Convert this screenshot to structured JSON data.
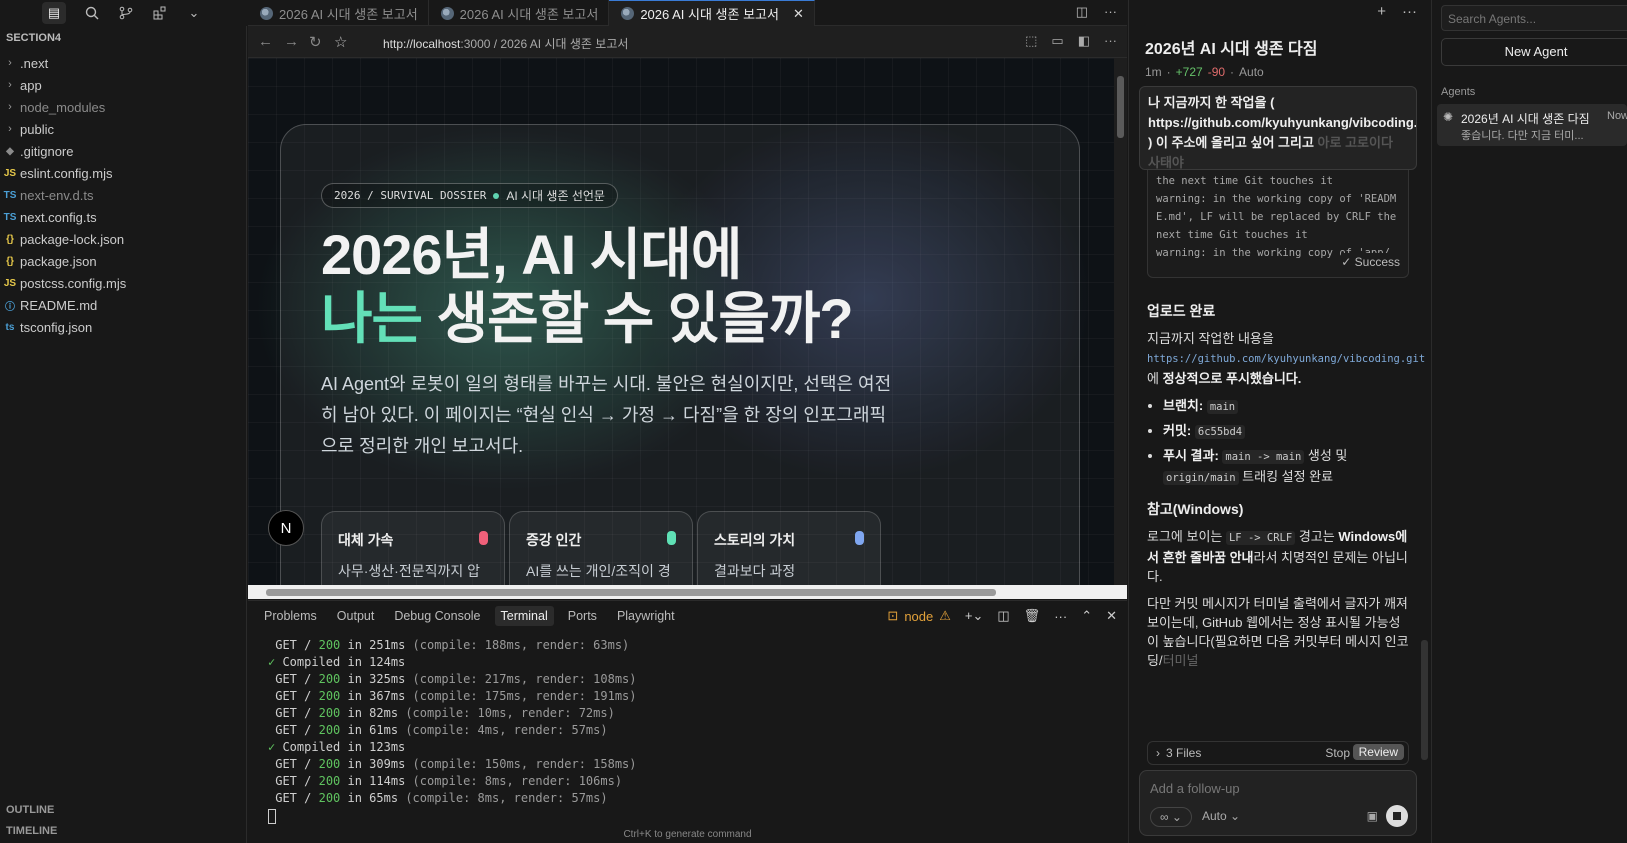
{
  "activity": {
    "icons": [
      "files-icon",
      "search-icon",
      "source-control-icon",
      "extensions-icon",
      "chevron-down-icon"
    ]
  },
  "explorer": {
    "section": "SECTION4",
    "items": [
      {
        "name": ".next",
        "type": "folder"
      },
      {
        "name": "app",
        "type": "folder"
      },
      {
        "name": "node_modules",
        "type": "folder",
        "dim": true
      },
      {
        "name": "public",
        "type": "folder"
      },
      {
        "name": ".gitignore",
        "type": "file",
        "icon": "◆",
        "color": "#8b8b8b"
      },
      {
        "name": "eslint.config.mjs",
        "type": "file",
        "icon": "JS",
        "color": "#e6c84a"
      },
      {
        "name": "next-env.d.ts",
        "type": "file",
        "icon": "TS",
        "color": "#4b9fd5",
        "dim": true
      },
      {
        "name": "next.config.ts",
        "type": "file",
        "icon": "TS",
        "color": "#4b9fd5"
      },
      {
        "name": "package-lock.json",
        "type": "file",
        "icon": "{}",
        "color": "#e6c84a"
      },
      {
        "name": "package.json",
        "type": "file",
        "icon": "{}",
        "color": "#e6c84a"
      },
      {
        "name": "postcss.config.mjs",
        "type": "file",
        "icon": "JS",
        "color": "#e6c84a"
      },
      {
        "name": "README.md",
        "type": "file",
        "icon": "ⓘ",
        "color": "#4b9fd5"
      },
      {
        "name": "tsconfig.json",
        "type": "file",
        "icon": "ts",
        "color": "#4b9fd5"
      }
    ],
    "outline": "OUTLINE",
    "timeline": "TIMELINE"
  },
  "tabs": [
    {
      "label": "2026 AI 시대 생존 보고서",
      "active": false
    },
    {
      "label": "2026 AI 시대 생존 보고서",
      "active": false
    },
    {
      "label": "2026 AI 시대 생존 보고서",
      "active": true
    }
  ],
  "browser": {
    "url_host": "http://localhost",
    "url_rest": ":3000 / 2026 AI 시대 생존 보고서"
  },
  "webpage": {
    "badge_left": "2026 / SURVIVAL DOSSIER",
    "badge_right": "AI 시대 생존 선언문",
    "hero_line1": "2026년, AI 시대에",
    "hero_accent": "나는",
    "hero_line2_rest": " 생존할 수 있을까?",
    "lead": "AI Agent와 로봇이 일의 형태를 바꾸는 시대. 불안은 현실이지만, 선택은 여전히 남아 있다. 이 페이지는 “현실 인식 → 가정 → 다짐”을 한 장의 인포그래픽으로 정리한 개인 보고서다.",
    "cards": [
      {
        "title": "대체 가속",
        "desc": "사무·생산·전문직까지 압력이 현실",
        "color": "#f0607a"
      },
      {
        "title": "증강 인간",
        "desc": "AI를 쓰는 개인/조직이 경쟁력을 갖는다",
        "color": "#5fe0b5"
      },
      {
        "title": "스토리의 가치",
        "desc": "결과보다 과정 (WHAT/WHY)이 중요",
        "color": "#7fa6f0"
      }
    ],
    "n_button": "N"
  },
  "panel": {
    "tabs": [
      "Problems",
      "Output",
      "Debug Console",
      "Terminal",
      "Ports",
      "Playwright"
    ],
    "active_tab": "Terminal",
    "node_label": "node",
    "terminal": [
      {
        "kind": "get",
        "route": "GET / ",
        "code": "200",
        "time": " in 251ms ",
        "detail": "(compile: 188ms, render: 63ms)"
      },
      {
        "kind": "compiled",
        "text": "Compiled in 124ms"
      },
      {
        "kind": "get",
        "route": "GET / ",
        "code": "200",
        "time": " in 325ms ",
        "detail": "(compile: 217ms, render: 108ms)"
      },
      {
        "kind": "get",
        "route": "GET / ",
        "code": "200",
        "time": " in 367ms ",
        "detail": "(compile: 175ms, render: 191ms)"
      },
      {
        "kind": "get",
        "route": "GET / ",
        "code": "200",
        "time": " in 82ms ",
        "detail": "(compile: 10ms, render: 72ms)"
      },
      {
        "kind": "get",
        "route": "GET / ",
        "code": "200",
        "time": " in 61ms ",
        "detail": "(compile: 4ms, render: 57ms)"
      },
      {
        "kind": "compiled",
        "text": "Compiled in 123ms"
      },
      {
        "kind": "get",
        "route": "GET / ",
        "code": "200",
        "time": " in 309ms ",
        "detail": "(compile: 150ms, render: 158ms)"
      },
      {
        "kind": "get",
        "route": "GET / ",
        "code": "200",
        "time": " in 114ms ",
        "detail": "(compile: 8ms, render: 106ms)"
      },
      {
        "kind": "get",
        "route": "GET / ",
        "code": "200",
        "time": " in 65ms ",
        "detail": "(compile: 8ms, render: 57ms)"
      }
    ],
    "hint": "Ctrl+K to generate command"
  },
  "chat": {
    "title": "2026년 AI 시대 생존 다짐",
    "age": "1m",
    "added": "+727",
    "removed": "-90",
    "model": "Auto",
    "query": "나 지금까지 한 작업을 ( https://github.com/kyuhyunkang/vibcoding.git ) 이 주소에 올리고 싶어 그리고",
    "query_fade": "아로 고로이다 사태야",
    "log": "the next time Git touches it\nwarning: in the working copy of 'README.md', LF will be replaced by CRLF the next time Git touches it\nwarning: in the working copy of 'app/",
    "log_status": "✓ Success",
    "h_upload": "업로드 완료",
    "p1_a": "지금까지 작업한 내용을 ",
    "p1_link": "https://github.com/kyuhyunkang/vibcoding.git",
    "p1_b": " 에 ",
    "p1_strong": "정상적으로 푸시",
    "p1_c": "했습니다.",
    "b1_label": "브랜치:",
    "b1_value": "main",
    "b2_label": "커밋:",
    "b2_value": "6c55bd4",
    "b3_label": "푸시 결과:",
    "b3_code1": "main -> main",
    "b3_mid": " 생성 및 ",
    "b3_code2": "origin/main",
    "b3_tail": " 트래킹 설정 완료",
    "h_note": "참고(Windows)",
    "p2_a": "로그에 보이는 ",
    "p2_code": "LF -> CRLF",
    "p2_b": " 경고는 ",
    "p2_strong": "Windows에서 흔한 줄바꿈 안내",
    "p2_c": "라서 치명적인 문제는 아닙니다.",
    "p3": "다만 커밋 메시지가 터미널 출력에서 글자가 깨져 보이는데, GitHub 웹에서는 정상 표시될 가능성이 높습니다(필요하면 다음 커밋부터 메시지 인코딩/",
    "p3_fade": "터미널",
    "files": "3 Files",
    "stop": "Stop",
    "review": "Review",
    "followup_placeholder": "Add a follow-up",
    "mode": "Auto"
  },
  "agents": {
    "search_placeholder": "Search Agents...",
    "new_label": "New Agent",
    "section": "Agents",
    "item_title": "2026년 AI 시대 생존 다짐",
    "item_sub": "좋습니다. 다만 지금 터미...",
    "item_time": "Now"
  }
}
